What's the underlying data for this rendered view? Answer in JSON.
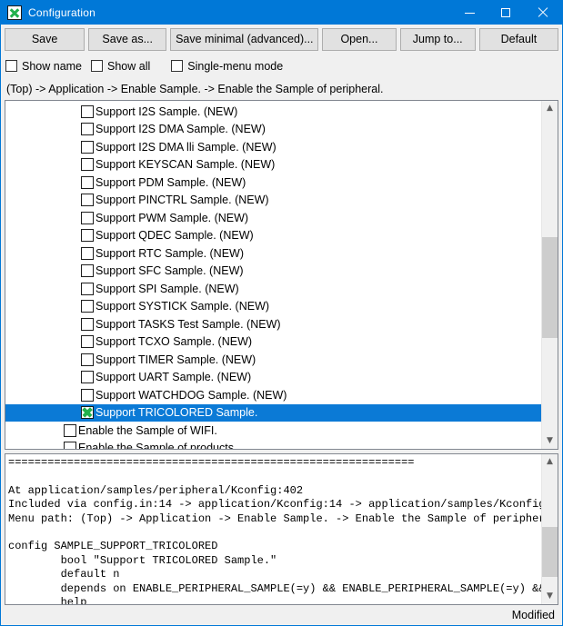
{
  "window": {
    "title": "Configuration",
    "icon": "green-x-checkbox-icon",
    "controls": {
      "minimize": "minimize-icon",
      "maximize": "maximize-icon",
      "close": "close-icon"
    },
    "accent_color": "#0078d7",
    "selection_color": "#0b7ad6",
    "check_color": "#22b14c"
  },
  "toolbar": {
    "buttons": [
      {
        "label": "Save",
        "name": "save-button"
      },
      {
        "label": "Save as...",
        "name": "save-as-button"
      },
      {
        "label": "Save minimal (advanced)...",
        "name": "save-minimal-button"
      },
      {
        "label": "Open...",
        "name": "open-button"
      },
      {
        "label": "Jump to...",
        "name": "jump-to-button"
      },
      {
        "label": "Default",
        "name": "default-button"
      }
    ]
  },
  "options": [
    {
      "label": "Show name",
      "checked": false
    },
    {
      "label": "Show all",
      "checked": false
    },
    {
      "label": "Single-menu mode",
      "checked": false
    }
  ],
  "breadcrumb": {
    "text": "(Top) -> Application -> Enable Sample. -> Enable the Sample of peripheral."
  },
  "config_list": {
    "items": [
      {
        "label": "Support I2S Sample. (NEW)",
        "checked": false,
        "indent": 2,
        "selected": false
      },
      {
        "label": "Support I2S DMA Sample. (NEW)",
        "checked": false,
        "indent": 2,
        "selected": false
      },
      {
        "label": "Support I2S DMA lli Sample. (NEW)",
        "checked": false,
        "indent": 2,
        "selected": false
      },
      {
        "label": "Support KEYSCAN Sample. (NEW)",
        "checked": false,
        "indent": 2,
        "selected": false
      },
      {
        "label": "Support PDM Sample. (NEW)",
        "checked": false,
        "indent": 2,
        "selected": false
      },
      {
        "label": "Support PINCTRL Sample. (NEW)",
        "checked": false,
        "indent": 2,
        "selected": false
      },
      {
        "label": "Support PWM Sample. (NEW)",
        "checked": false,
        "indent": 2,
        "selected": false
      },
      {
        "label": "Support QDEC Sample. (NEW)",
        "checked": false,
        "indent": 2,
        "selected": false
      },
      {
        "label": "Support RTC Sample. (NEW)",
        "checked": false,
        "indent": 2,
        "selected": false
      },
      {
        "label": "Support SFC Sample. (NEW)",
        "checked": false,
        "indent": 2,
        "selected": false
      },
      {
        "label": "Support SPI Sample. (NEW)",
        "checked": false,
        "indent": 2,
        "selected": false
      },
      {
        "label": "Support SYSTICK Sample. (NEW)",
        "checked": false,
        "indent": 2,
        "selected": false
      },
      {
        "label": "Support TASKS Test Sample. (NEW)",
        "checked": false,
        "indent": 2,
        "selected": false
      },
      {
        "label": "Support TCXO Sample. (NEW)",
        "checked": false,
        "indent": 2,
        "selected": false
      },
      {
        "label": "Support TIMER Sample. (NEW)",
        "checked": false,
        "indent": 2,
        "selected": false
      },
      {
        "label": "Support UART Sample. (NEW)",
        "checked": false,
        "indent": 2,
        "selected": false
      },
      {
        "label": "Support WATCHDOG Sample. (NEW)",
        "checked": false,
        "indent": 2,
        "selected": false
      },
      {
        "label": "Support TRICOLORED Sample.",
        "checked": true,
        "indent": 2,
        "selected": true
      },
      {
        "label": "Enable the Sample of WIFI.",
        "checked": false,
        "indent": 1,
        "selected": false
      },
      {
        "label": "Enable the Sample of products.",
        "checked": false,
        "indent": 1,
        "selected": false
      }
    ],
    "scrollbar": {
      "up_arrow": "chevron-up-icon",
      "down_arrow": "chevron-down-icon",
      "thumb_top_pct": 38,
      "thumb_height_pct": 32
    }
  },
  "help_panel": {
    "text": "==============================================================\n\nAt application/samples/peripheral/Kconfig:402\nIncluded via config.in:14 -> application/Kconfig:14 -> application/samples/Kconfig:27\nMenu path: (Top) -> Application -> Enable Sample. -> Enable the Sample of peripheral.\n\nconfig SAMPLE_SUPPORT_TRICOLORED\n        bool \"Support TRICOLORED Sample.\"\n        default n\n        depends on ENABLE_PERIPHERAL_SAMPLE(=y) && ENABLE_PERIPHERAL_SAMPLE(=y) && SAM\n        help\n          This option means support TRICOLORED Sample.",
    "scrollbar": {
      "up_arrow": "chevron-up-icon",
      "down_arrow": "chevron-down-icon",
      "thumb_top_pct": 48,
      "thumb_height_pct": 42
    }
  },
  "status_bar": {
    "text": "Modified"
  }
}
